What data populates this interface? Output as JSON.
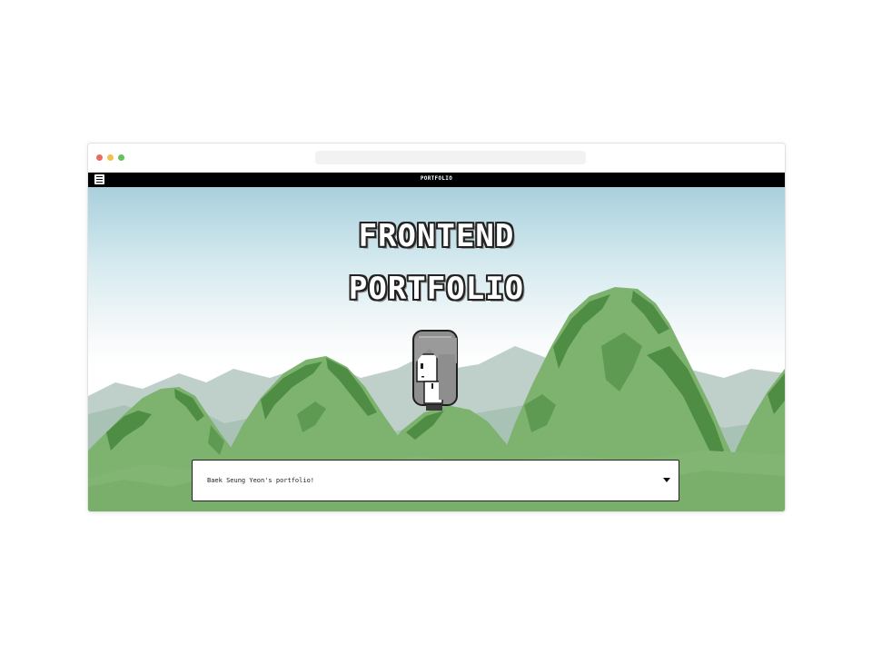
{
  "browser": {
    "controls": [
      {
        "name": "close",
        "color": "#ec6a5e"
      },
      {
        "name": "minimize",
        "color": "#f4bf4f"
      },
      {
        "name": "maximize",
        "color": "#61c554"
      }
    ],
    "url": ""
  },
  "navbar": {
    "menu_icon": "hamburger-menu-icon",
    "title": "PORTFOLIO"
  },
  "hero": {
    "line1": "FRONTEND",
    "line2": "PORTFOLIO"
  },
  "dropdown": {
    "selected": "Baek Seung Yeon's portfolio!",
    "caret_icon": "caret-down-icon"
  },
  "colors": {
    "navbar_bg": "#000000",
    "sky_top": "#a9d0dc",
    "mountain_light": "#7db36f",
    "mountain_dark": "#4f8d44",
    "mountain_far": "#b9ccc6"
  }
}
